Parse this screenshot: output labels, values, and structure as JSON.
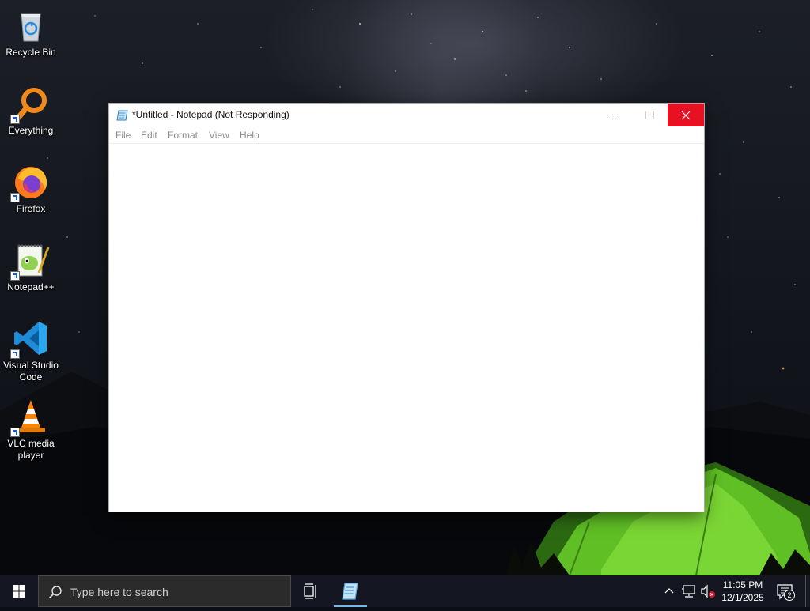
{
  "desktop": {
    "icons": [
      {
        "label": "Recycle Bin",
        "icon": "recycle-bin-icon"
      },
      {
        "label": "Everything",
        "icon": "everything-search-icon"
      },
      {
        "label": "Firefox",
        "icon": "firefox-icon"
      },
      {
        "label": "Notepad++",
        "icon": "notepad-plus-plus-icon"
      },
      {
        "label": "Visual Studio Code",
        "icon": "vscode-icon"
      },
      {
        "label": "VLC media player",
        "icon": "vlc-icon"
      }
    ]
  },
  "notepad": {
    "title": "*Untitled - Notepad (Not Responding)",
    "menu": [
      "File",
      "Edit",
      "Format",
      "View",
      "Help"
    ],
    "content": "",
    "close_color": "#e81123"
  },
  "taskbar": {
    "search_placeholder": "Type here to search",
    "time": "11:05 PM",
    "date": "12/1/2025",
    "notification_count": "2",
    "active_app_indicator_color": "#76b9ed",
    "background": "#141722"
  }
}
